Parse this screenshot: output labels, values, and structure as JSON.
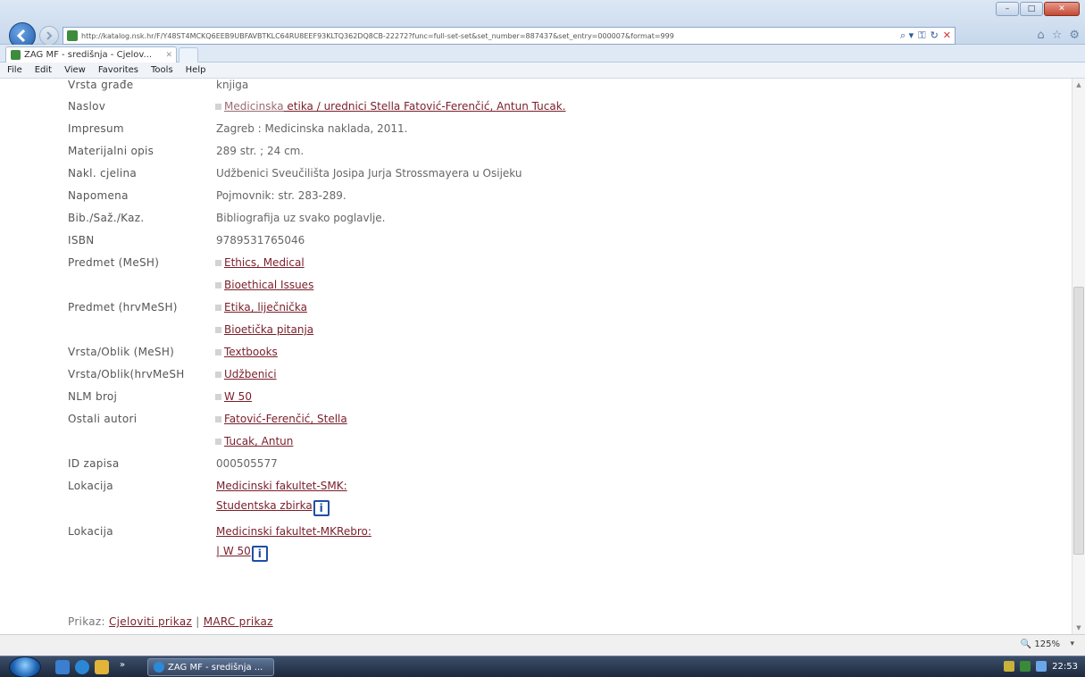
{
  "window": {
    "controls": {
      "minimize": "–",
      "maximize": "□",
      "close": "✕"
    }
  },
  "browser": {
    "url": "http://katalog.nsk.hr/F/Y48ST4MCKQ6EEB9UBFAVBTKLC64RU8EEF93KLTQ362DQ8CB-22272?func=full-set-set&set_number=887437&set_entry=000007&format=999",
    "search_icon": "magnifier-icon",
    "address_tools": [
      "⌕ ▾",
      "⚿",
      "↻",
      "✕"
    ],
    "fav_icons": [
      "⌂",
      "☆",
      "⚙"
    ],
    "tab_title": "ZAG MF - središnja - Cjelov...",
    "tab_close": "✕"
  },
  "menu": [
    "File",
    "Edit",
    "View",
    "Favorites",
    "Tools",
    "Help"
  ],
  "record": {
    "vrsta_grade": {
      "label": "Vrsta građe",
      "value": "knjiga"
    },
    "naslov": {
      "label": "Naslov",
      "value_a": "Medicinska",
      "value_b": " etika / urednici Stella Fatović-Ferenčić, Antun Tucak."
    },
    "impresum": {
      "label": "Impresum",
      "value": "Zagreb : Medicinska naklada, 2011."
    },
    "materijalni_opis": {
      "label": "Materijalni opis",
      "value": "289 str. ; 24 cm."
    },
    "nakl_cjelina": {
      "label": "Nakl. cjelina",
      "value": "Udžbenici Sveučilišta Josipa Jurja Strossmayera u Osijeku"
    },
    "napomena": {
      "label": "Napomena",
      "value": "Pojmovnik: str. 283-289."
    },
    "bib": {
      "label": "Bib./Saž./Kaz.",
      "value": "Bibliografija uz svako poglavlje."
    },
    "isbn": {
      "label": "ISBN",
      "value": "9789531765046"
    },
    "predmet_mesh": {
      "label": "Predmet (MeSH)",
      "items": [
        "Ethics, Medical",
        "Bioethical Issues"
      ]
    },
    "predmet_hrvmesh": {
      "label": "Predmet (hrvMeSH)",
      "items": [
        "Etika, liječnička",
        "Bioetička pitanja"
      ]
    },
    "vrsta_mesh": {
      "label": "Vrsta/Oblik (MeSH)",
      "items": [
        "Textbooks"
      ]
    },
    "vrsta_hrvmesh": {
      "label": "Vrsta/Oblik(hrvMeSH",
      "items": [
        "Udžbenici"
      ]
    },
    "nlm": {
      "label": "NLM broj",
      "items": [
        "W 50"
      ]
    },
    "ostali_autori": {
      "label": "Ostali autori",
      "items": [
        "Fatović-Ferenčić, Stella",
        "Tucak, Antun"
      ]
    },
    "id_zapisa": {
      "label": "ID zapisa",
      "value": "000505577"
    },
    "lokacija1": {
      "label": "Lokacija",
      "link": "Medicinski fakultet-SMK:",
      "sub": "Studentska zbirka"
    },
    "lokacija2": {
      "label": "Lokacija",
      "link": "Medicinski fakultet-MKRebro:",
      "sub": " | W 50"
    },
    "info_glyph": "i"
  },
  "footer": {
    "prikaz_label": "Prikaz:",
    "cjeloviti": "Cjeloviti prikaz",
    "separator": "|",
    "marc": "MARC prikaz"
  },
  "statusbar": {
    "zoom": "🔍 125%",
    "zoom_arrow": "▾"
  },
  "taskbar": {
    "task_label": "ZAG MF - središnja ...",
    "clock": "22:53"
  },
  "colors": {
    "link": "#7a1e2a",
    "label": "#555555",
    "value": "#666666",
    "info_border": "#1f4ea6"
  }
}
